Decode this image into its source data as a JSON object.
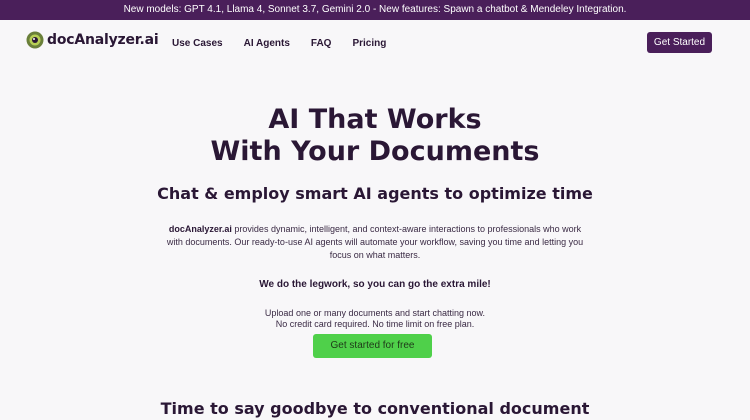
{
  "announcement": {
    "text": "New models: GPT 4.1, Llama 4, Sonnet 3.7, Gemini 2.0 - New features: Spawn a chatbot & Mendeley Integration."
  },
  "header": {
    "logo_text": "docAnalyzer.ai",
    "nav": [
      "Use Cases",
      "AI Agents",
      "FAQ",
      "Pricing"
    ],
    "cta_label": "Get Started"
  },
  "hero": {
    "title_line1": "AI That Works",
    "title_line2": "With Your Documents",
    "subtitle": "Chat & employ smart AI agents to optimize time",
    "desc_brand": "docAnalyzer.ai",
    "desc_rest": " provides dynamic, intelligent, and context-aware interactions to professionals who work with documents. Our ready-to-use AI agents will automate your workflow, saving you time and letting you focus on what matters.",
    "tagline": "We do the legwork, so you can go the extra mile!",
    "upload_line1": "Upload one or many documents and start chatting now.",
    "upload_line2": "No credit card required. No time limit on free plan.",
    "cta_label": "Get started for free"
  },
  "section": {
    "title": "Time to say goodbye to conventional document"
  },
  "colors": {
    "brand": "#4a1f5a",
    "cta_green": "#4fd04a",
    "text_dark": "#2a1735",
    "background": "#f8f7f9"
  }
}
